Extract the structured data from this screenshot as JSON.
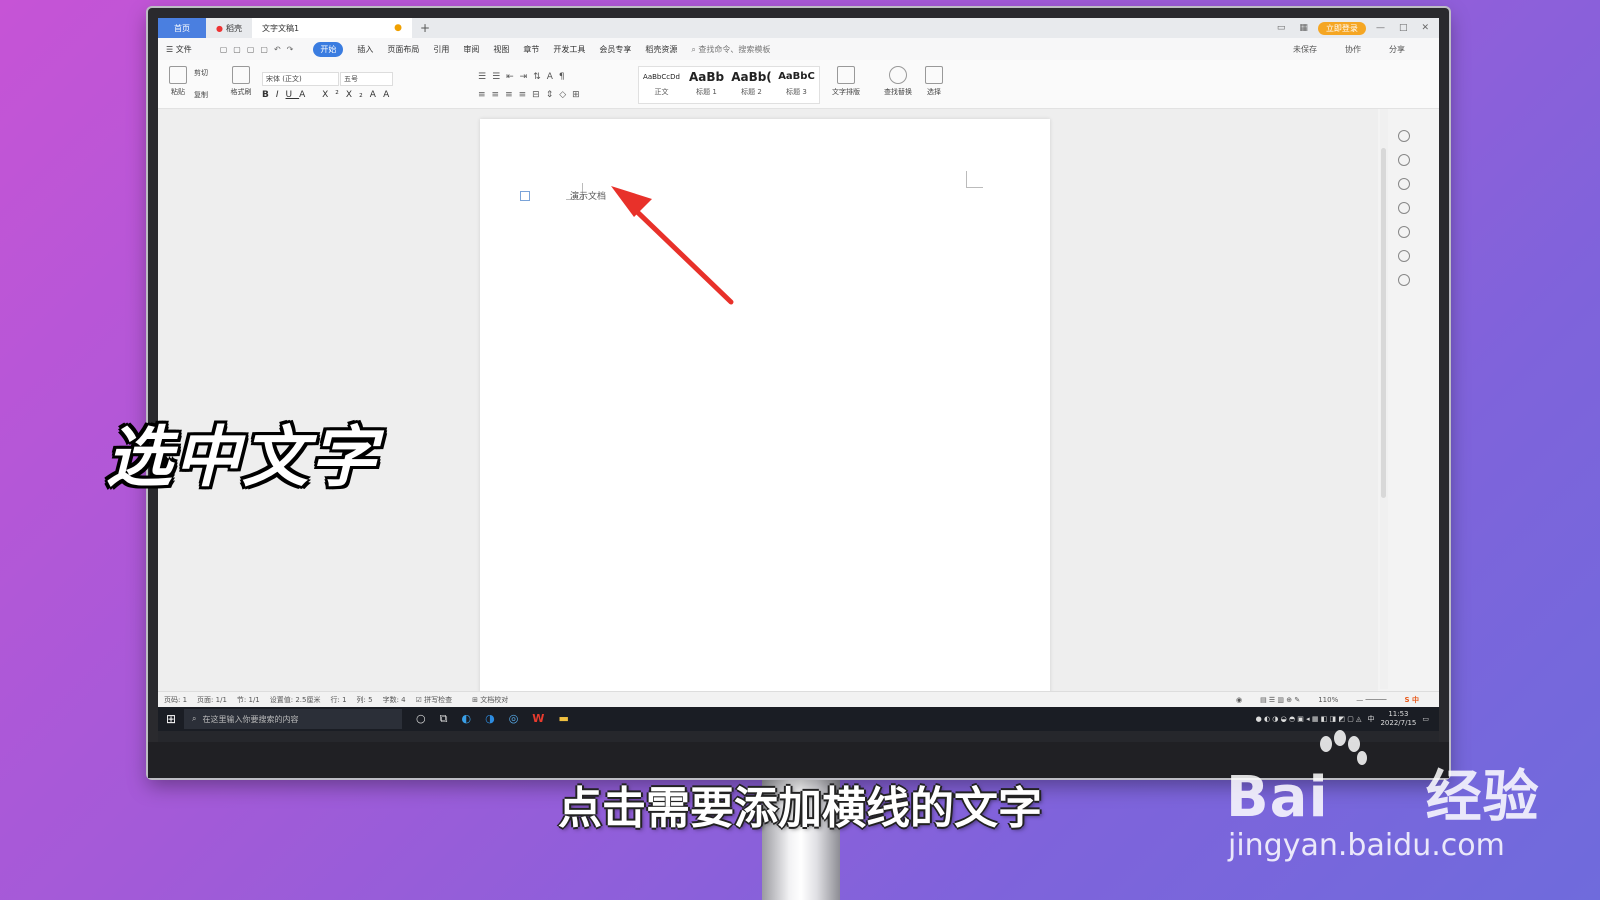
{
  "tabs": {
    "home": "首页",
    "template": "稻壳",
    "document": "文字文稿1",
    "login": "立即登录"
  },
  "menu": {
    "file": "文件",
    "items": [
      "开始",
      "插入",
      "页面布局",
      "引用",
      "审阅",
      "视图",
      "章节",
      "开发工具",
      "会员专享",
      "稻壳资源"
    ],
    "active_index": 0,
    "search": "查找命令、搜索模板",
    "unsaved": "未保存",
    "collab": "协作",
    "share": "分享"
  },
  "ribbon": {
    "paste": "粘贴",
    "cut": "剪切",
    "copy": "复制",
    "format_painter": "格式刷",
    "font_name": "宋体 (正文)",
    "font_size": "五号",
    "styles": [
      {
        "sample": "AaBbCcDd",
        "name": "正文"
      },
      {
        "sample": "AaBb",
        "name": "标题 1"
      },
      {
        "sample": "AaBb(",
        "name": "标题 2"
      },
      {
        "sample": "AaBbC",
        "name": "标题 3"
      }
    ],
    "text_layout": "文字排版",
    "find_replace": "查找替换",
    "select": "选择"
  },
  "document": {
    "text": "演示文档"
  },
  "status": {
    "page": "页码: 1",
    "pages": "页面: 1/1",
    "section": "节: 1/1",
    "setting": "设置值: 2.5厘米",
    "row": "行: 1",
    "col": "列: 5",
    "words": "字数: 4",
    "spell": "拼写检查",
    "proof": "文档校对",
    "zoom": "110%"
  },
  "taskbar": {
    "search_placeholder": "在这里输入你要搜索的内容",
    "time": "11:53",
    "date": "2022/7/15",
    "ime": "中"
  },
  "overlay": {
    "step_title": "选中文字",
    "subtitle": "点击需要添加横线的文字"
  },
  "watermark": {
    "brand": "Bai",
    "brand2": "经验",
    "url": "jingyan.baidu.com"
  },
  "colors": {
    "arrow": "#e8312a",
    "accent": "#3a7ce0"
  }
}
